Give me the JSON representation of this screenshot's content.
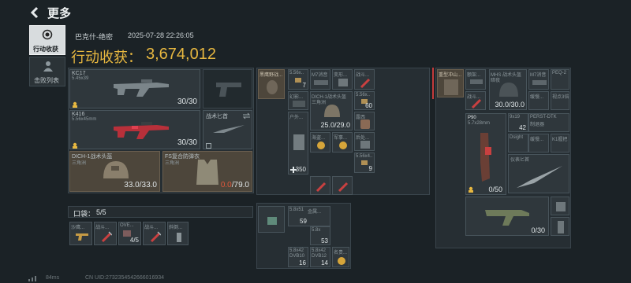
{
  "header": {
    "title": "更多"
  },
  "sidebar": {
    "tabs": [
      {
        "label": "行动收获"
      },
      {
        "label": "击败列表"
      }
    ]
  },
  "summary": {
    "map_name": "巴克什-绝密",
    "datetime": "2025-07-28 22:26:05",
    "earnings_label": "行动收获：",
    "earnings_value": "3,674,012"
  },
  "weapons": [
    {
      "name": "KC17",
      "caliber": "5.45x39",
      "ammo": "30/30"
    },
    {
      "name": "K416",
      "caliber": "5.56x45mm",
      "ammo": "30/30"
    }
  ],
  "melee": {
    "name": "战术匕首"
  },
  "helmet": {
    "name": "DICH-1战术头盔",
    "sub": "三角洲",
    "durability": "33.0/33.0"
  },
  "armor": {
    "name": "FS复合防弹衣",
    "sub": "三角洲",
    "durability_current": "0.0",
    "durability_max": "/79.0"
  },
  "pocket": {
    "label": "口袋：",
    "count": "5/5"
  },
  "pocket_items": [
    {
      "name": "沙鹰..."
    },
    {
      "name": "战斗..."
    },
    {
      "name": "OVE...",
      "count": "4/5"
    },
    {
      "name": "战斗..."
    },
    {
      "name": "斜倒..."
    }
  ],
  "backpack1": {
    "items": [
      {
        "name": "黑鹰野战..."
      },
      {
        "name": "5.56x..",
        "count": "7"
      },
      {
        "name": "M7消音"
      },
      {
        "name": "变形..."
      },
      {
        "name": "战斗..."
      },
      {
        "name": "幻影..."
      },
      {
        "name": "5.56x..",
        "count": "60"
      },
      {
        "name": "DICH-1战术头盔",
        "sub": "三角洲",
        "durability": "25.0/29.0"
      },
      {
        "name": "露西"
      },
      {
        "name": "户外...",
        "count": "350"
      },
      {
        "name": "后处..."
      },
      {
        "name": "海盗..."
      },
      {
        "name": "军事..."
      },
      {
        "name": "5.56x4..",
        "count": "9"
      }
    ]
  },
  "backpack2": {
    "items": [
      {
        "name": "5.8x51",
        "sub": "金属...",
        "count": "59"
      },
      {
        "name": "5.8x",
        "count": "53"
      },
      {
        "name": "5.8x42",
        "sub": "DVB10",
        "count": "16"
      },
      {
        "name": "5.8x42",
        "sub": "DVB12",
        "count": "14"
      },
      {
        "name": "名贵..."
      }
    ]
  },
  "stash": {
    "items": [
      {
        "name": "重型冲山..."
      },
      {
        "name": "额架..."
      },
      {
        "name": "MHS 战术头盔",
        "sub": "暗夜",
        "durability": "30.0/30.0"
      },
      {
        "name": "M7消音"
      },
      {
        "name": "PEQ-2"
      },
      {
        "name": "战斗..."
      },
      {
        "name": "缓慢..."
      },
      {
        "name": "视点3倍"
      },
      {
        "name": "P90",
        "sub": "5.7x28mm",
        "ammo": "0/50"
      },
      {
        "name": "9x19",
        "count": "42"
      },
      {
        "name": "PERST-DTK",
        "sub": "制退器"
      },
      {
        "name": "Dsight"
      },
      {
        "name": "缓慢..."
      },
      {
        "name": "K1握把"
      },
      {
        "name": "仪表匕首"
      },
      {
        "name": "SMG",
        "ammo": "0/30"
      }
    ]
  },
  "footer": {
    "ping": "84ms",
    "uid": "CN UID:2732354542666016934"
  }
}
